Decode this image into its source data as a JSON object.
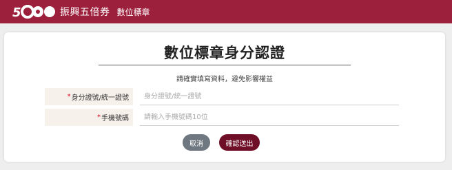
{
  "header": {
    "logo_text": "5000",
    "brand": "振興五倍券",
    "nav_title": "數位標章"
  },
  "form": {
    "title": "數位標章身分認證",
    "subtitle": "請確實填寫資料，避免影響權益",
    "required_mark": "*",
    "fields": [
      {
        "label": "身分證號/統一證號",
        "placeholder": "身分證號/統一證號",
        "value": ""
      },
      {
        "label": "手機號碼",
        "placeholder": "請輸入手機號碼10位",
        "value": ""
      }
    ]
  },
  "actions": {
    "cancel_label": "取消",
    "confirm_label": "確認送出"
  },
  "colors": {
    "header_bg": "#9c1f3c",
    "confirm_bg": "#6e0e27",
    "cancel_bg": "#6f7880",
    "label_bg": "#f7f1ec",
    "required": "#d0021b"
  }
}
